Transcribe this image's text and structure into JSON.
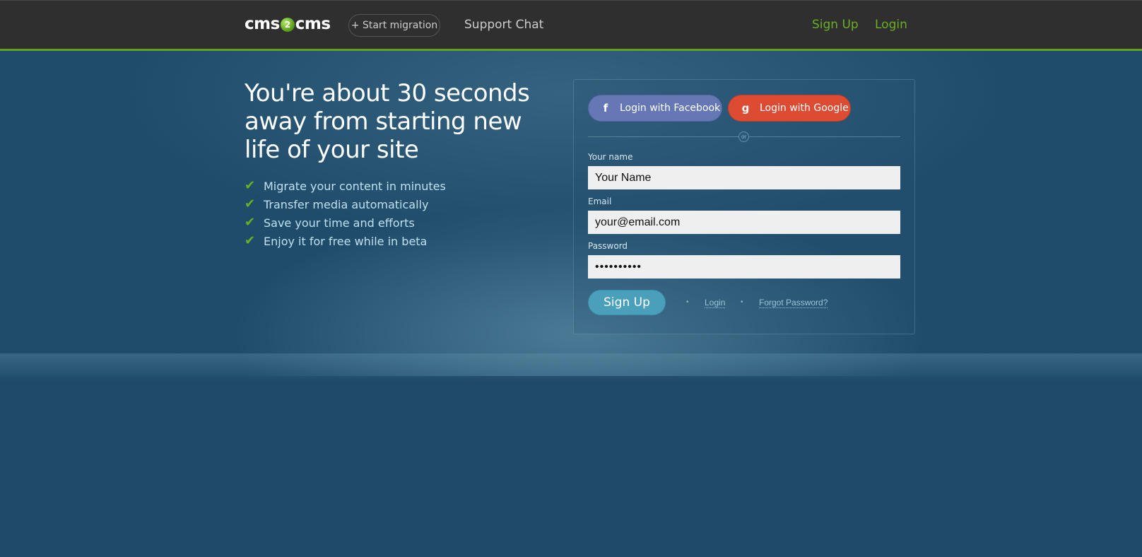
{
  "nav": {
    "logo_left": "cms",
    "logo_mid": "2",
    "logo_right": "cms",
    "start_migration": "+ Start migration",
    "support_chat": "Support Chat",
    "sign_up": "Sign Up",
    "login": "Login"
  },
  "hero": {
    "headline": "You're about 30 seconds away from starting new life of your site",
    "features": [
      "Migrate your content in minutes",
      "Transfer media automatically",
      "Save your time and efforts",
      "Enjoy it for free while in beta"
    ]
  },
  "form": {
    "facebook_label": "Login with Facebook",
    "facebook_icon": "f",
    "google_label": "Login with Google",
    "google_icon": "g",
    "or_label": "or",
    "name_label": "Your name",
    "name_value": "Your Name",
    "email_label": "Email",
    "email_value": "your@email.com",
    "password_label": "Password",
    "password_value": "••••••••••",
    "signup_button": "Sign Up",
    "login_link": "Login",
    "forgot_link": "Forgot Password?"
  },
  "colors": {
    "accent_green": "#6ab023",
    "facebook": "#6577b5",
    "google": "#dd4b33",
    "signup": "#4aa0bb",
    "background": "#1f4a69"
  }
}
